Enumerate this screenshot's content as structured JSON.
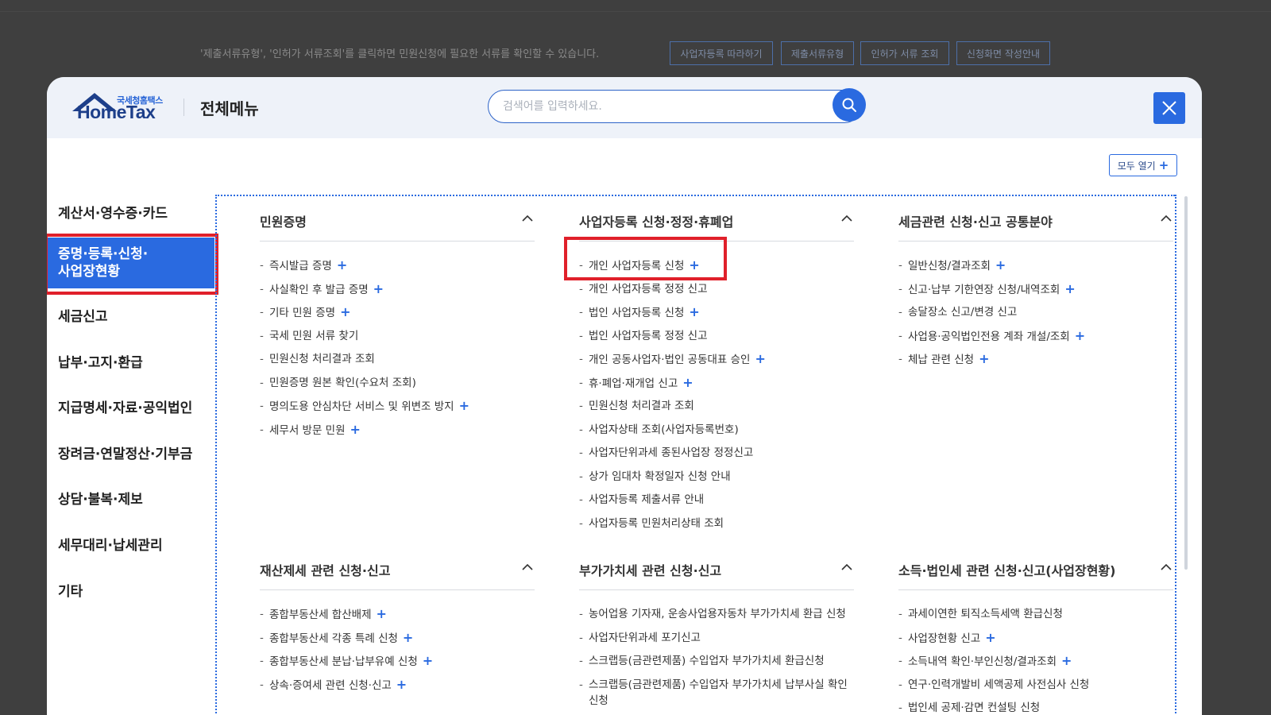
{
  "background": {
    "notice": "'제출서류유형', '인허가 서류조회'를 클릭하면 민원신청에 필요한 서류를 확인할 수 있습니다.",
    "buttons": [
      "사업자등록 따라하기",
      "제출서류유형",
      "인허가 서류 조회",
      "신청화면 작성안내"
    ]
  },
  "header": {
    "logo_small": "국세청홈택스",
    "logo_main": "HomeTax",
    "title": "전체메뉴",
    "search_placeholder": "검색어를 입력하세요.",
    "expand_all": "모두 열기"
  },
  "colors": {
    "accent": "#2a6ae0",
    "highlight": "#e0202a"
  },
  "nav": {
    "items": [
      "계산서·영수증·카드",
      "증명·등록·신청·사업장현황",
      "세금신고",
      "납부·고지·환급",
      "지급명세·자료·공익법인",
      "장려금·연말정산·기부금",
      "상담·불복·제보",
      "세무대리·납세관리",
      "기타"
    ],
    "active_line1": "증명·등록·신청·",
    "active_line2": "사업장현황"
  },
  "sections": [
    {
      "title": "민원증명",
      "items": [
        {
          "label": "즉시발급 증명",
          "plus": true
        },
        {
          "label": "사실확인 후 발급 증명",
          "plus": true
        },
        {
          "label": "기타 민원 증명",
          "plus": true
        },
        {
          "label": "국세 민원 서류 찾기",
          "plus": false
        },
        {
          "label": "민원신청 처리결과 조회",
          "plus": false
        },
        {
          "label": "민원증명 원본 확인(수요처 조회)",
          "plus": false
        },
        {
          "label": "명의도용 안심차단 서비스 및 위변조 방지",
          "plus": true
        },
        {
          "label": "세무서 방문 민원",
          "plus": true
        }
      ]
    },
    {
      "title": "사업자등록 신청·정정·휴폐업",
      "items": [
        {
          "label": "개인 사업자등록 신청",
          "plus": true
        },
        {
          "label": "개인 사업자등록 정정 신고",
          "plus": false
        },
        {
          "label": "법인 사업자등록 신청",
          "plus": true
        },
        {
          "label": "법인 사업자등록 정정 신고",
          "plus": false
        },
        {
          "label": "개인 공동사업자·법인 공동대표 승인",
          "plus": true
        },
        {
          "label": "휴·폐업·재개업 신고",
          "plus": true
        },
        {
          "label": "민원신청 처리결과 조회",
          "plus": false
        },
        {
          "label": "사업자상태 조회(사업자등록번호)",
          "plus": false
        },
        {
          "label": "사업자단위과세 종된사업장 정정신고",
          "plus": false
        },
        {
          "label": "상가 임대차 확정일자 신청 안내",
          "plus": false
        },
        {
          "label": "사업자등록 제출서류 안내",
          "plus": false
        },
        {
          "label": "사업자등록 민원처리상태 조회",
          "plus": false
        }
      ]
    },
    {
      "title": "세금관련 신청·신고 공통분야",
      "items": [
        {
          "label": "일반신청/결과조회",
          "plus": true
        },
        {
          "label": "신고·납부 기한연장 신청/내역조회",
          "plus": true
        },
        {
          "label": "송달장소 신고/변경 신고",
          "plus": false
        },
        {
          "label": "사업용·공익법인전용 계좌 개설/조회",
          "plus": true
        },
        {
          "label": "체납 관련 신청",
          "plus": true
        }
      ]
    },
    {
      "title": "재산제세 관련 신청·신고",
      "items": [
        {
          "label": "종합부동산세 합산배제",
          "plus": true
        },
        {
          "label": "종합부동산세 각종 특례 신청",
          "plus": true
        },
        {
          "label": "종합부동산세 분납·납부유예 신청",
          "plus": true
        },
        {
          "label": "상속·증여세 관련 신청·신고",
          "plus": true
        }
      ]
    },
    {
      "title": "부가가치세 관련 신청·신고",
      "items": [
        {
          "label": "농어업용 기자재, 운송사업용자동차 부가가치세 환급 신청",
          "plus": false
        },
        {
          "label": "사업자단위과세 포기신고",
          "plus": false
        },
        {
          "label": "스크랩등(금관련제품) 수입업자 부가가치세 환급신청",
          "plus": false
        },
        {
          "label": "스크랩등(금관련제품) 수입업자 부가가치세 납부사실 확인신청",
          "plus": false
        }
      ]
    },
    {
      "title": "소득·법인세 관련 신청·신고(사업장현황)",
      "items": [
        {
          "label": "과세이연한 퇴직소득세액 환급신청",
          "plus": false
        },
        {
          "label": "사업장현황 신고",
          "plus": true
        },
        {
          "label": "소득내역 확인·부인신청/결과조회",
          "plus": true
        },
        {
          "label": "연구·인력개발비 세액공제 사전심사 신청",
          "plus": false
        },
        {
          "label": "법인세 공제·감면 컨설팅 신청",
          "plus": false
        }
      ]
    }
  ]
}
